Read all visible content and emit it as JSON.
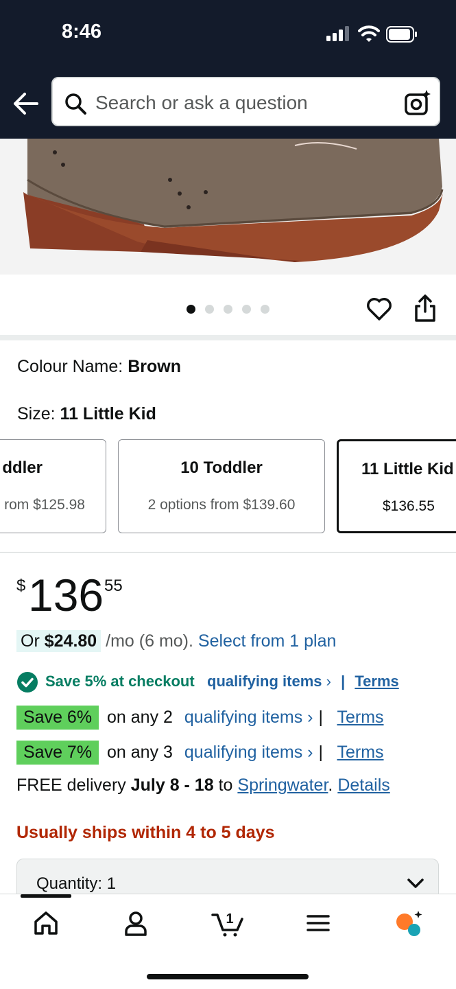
{
  "status_bar": {
    "time": "8:46"
  },
  "search": {
    "placeholder": "Search or ask a question"
  },
  "carousel": {
    "count": 5,
    "active": 1
  },
  "variations": {
    "colour_label": "Colour Name:",
    "colour_value": "Brown",
    "size_label": "Size:",
    "size_value": "11 Little Kid",
    "tiles": [
      {
        "name": "ddler",
        "price": "rom $125.98"
      },
      {
        "name": "10 Toddler",
        "price": "2 options from $139.60"
      },
      {
        "name": "11 Little Kid",
        "price": "$136.55"
      }
    ]
  },
  "price": {
    "currency": "$",
    "whole": "136",
    "fraction": "55"
  },
  "installment": {
    "prefix": "Or",
    "amount": "$24.80",
    "term": "/mo (6 mo).",
    "link": "Select from 1 plan"
  },
  "promos": {
    "checkout": {
      "text": "Save 5% at checkout",
      "link": "qualifying items",
      "chev": "›",
      "sep": "|",
      "terms": "Terms"
    },
    "rows": [
      {
        "badge": "Save 6%",
        "text": "on any 2",
        "link": "qualifying items",
        "chev": "›",
        "sep": "|",
        "terms": "Terms"
      },
      {
        "badge": "Save 7%",
        "text": "on any 3",
        "link": "qualifying items",
        "chev": "›",
        "sep": "|",
        "terms": "Terms"
      }
    ]
  },
  "delivery": {
    "prefix": "FREE delivery",
    "dates": "July 8 - 18",
    "to": "to",
    "location": "Springwater",
    "dot": ".",
    "details": "Details"
  },
  "shipping_note": "Usually ships within 4 to 5 days",
  "quantity": {
    "label": "Quantity: 1"
  },
  "nav": {
    "cart_count": "1"
  },
  "colors": {
    "header_bg": "#131b2b",
    "link": "#2162a1",
    "save_green": "#5fcf5c",
    "deal_red": "#b12704",
    "teal": "#067d62"
  }
}
